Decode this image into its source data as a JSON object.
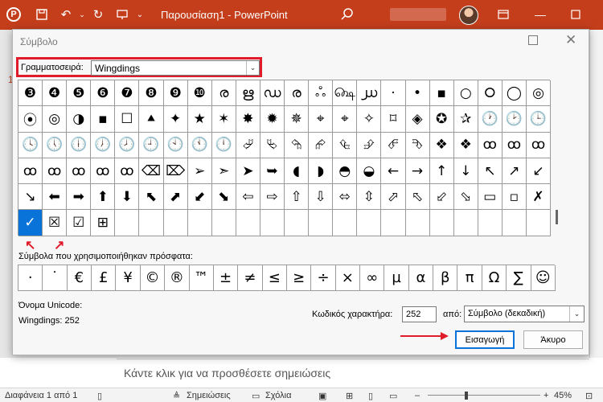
{
  "app": {
    "title": "Παρουσίαση1  -  PowerPoint",
    "logo_letter": "P"
  },
  "dialog": {
    "title": "Σύμβολο",
    "font_label": "Γραμματοσειρά:",
    "font_value": "Wingdings",
    "recent_label": "Σύμβολα που χρησιμοποιήθηκαν πρόσφατα:",
    "unicode_name_label": "Όνομα Unicode:",
    "unicode_name_value": "Wingdings: 252",
    "char_code_label": "Κωδικός χαρακτήρα:",
    "char_code_value": "252",
    "from_label": "από:",
    "from_value": "Σύμβολο (δεκαδική)",
    "insert_button": "Εισαγωγή",
    "cancel_button": "Άκυρο"
  },
  "symbol_grid": {
    "selected_index": 110,
    "rows": [
      [
        "❸",
        "❹",
        "❺",
        "❻",
        "❼",
        "❽",
        "❾",
        "❿",
        "ര",
        "ഋ",
        "ഡ",
        "ര",
        "ஃ",
        "௸",
        "൰",
        "·",
        "•",
        "▪",
        "○",
        "⭘",
        "◯",
        "◎"
      ],
      [
        "⦿",
        "◎",
        "◑",
        "▪",
        "☐",
        "⯅",
        "✦",
        "★",
        "✶",
        "✸",
        "✹",
        "✵",
        "⌖",
        "⌖",
        "✧",
        "⌑",
        "◈",
        "✪",
        "✰",
        "🕐",
        "🕑",
        "🕒"
      ],
      [
        "🕓",
        "🕔",
        "🕕",
        "🕖",
        "🕗",
        "🕘",
        "🕙",
        "🕚",
        "🕛",
        "⮰",
        "⮱",
        "⮲",
        "⮳",
        "⮴",
        "⮵",
        "⮶",
        "⮷",
        "❖",
        "❖",
        "ꝏ",
        "ꝏ",
        "ꝏ"
      ],
      [
        "ꝏ",
        "ꝏ",
        "ꝏ",
        "ꝏ",
        "ꝏ",
        "⌫",
        "⌦",
        "➢",
        "➣",
        "➤",
        "➥",
        "◖",
        "◗",
        "◓",
        "◒",
        "←",
        "→",
        "↑",
        "↓",
        "↖",
        "↗",
        "↙"
      ],
      [
        "↘",
        "⬅",
        "➡",
        "⬆",
        "⬇",
        "⬉",
        "⬈",
        "⬋",
        "⬊",
        "⇦",
        "⇨",
        "⇧",
        "⇩",
        "⬄",
        "⇳",
        "⬀",
        "⬁",
        "⬃",
        "⬂",
        "▭",
        "▫",
        "✗"
      ],
      [
        "✓",
        "☒",
        "☑",
        "⊞",
        "",
        "",
        "",
        "",
        "",
        "",
        "",
        "",
        "",
        "",
        "",
        "",
        "",
        "",
        "",
        "",
        "",
        ""
      ]
    ]
  },
  "recent_symbols": [
    "·",
    "˙",
    "€",
    "£",
    "¥",
    "©",
    "®",
    "™",
    "±",
    "≠",
    "≤",
    "≥",
    "÷",
    "×",
    "∞",
    "µ",
    "α",
    "β",
    "π",
    "Ω",
    "∑",
    "☺"
  ],
  "background": {
    "slide_number": "1",
    "notes_placeholder": "Κάντε κλικ για να προσθέσετε σημειώσεις"
  },
  "status": {
    "slide_info": "Διαφάνεια 1 από 1",
    "notes_label": "Σημειώσεις",
    "comments_label": "Σχόλια",
    "zoom": "45%"
  },
  "colors": {
    "titlebar": "#c43e1c",
    "highlight": "#e01b2a",
    "selection": "#0a73d9"
  }
}
